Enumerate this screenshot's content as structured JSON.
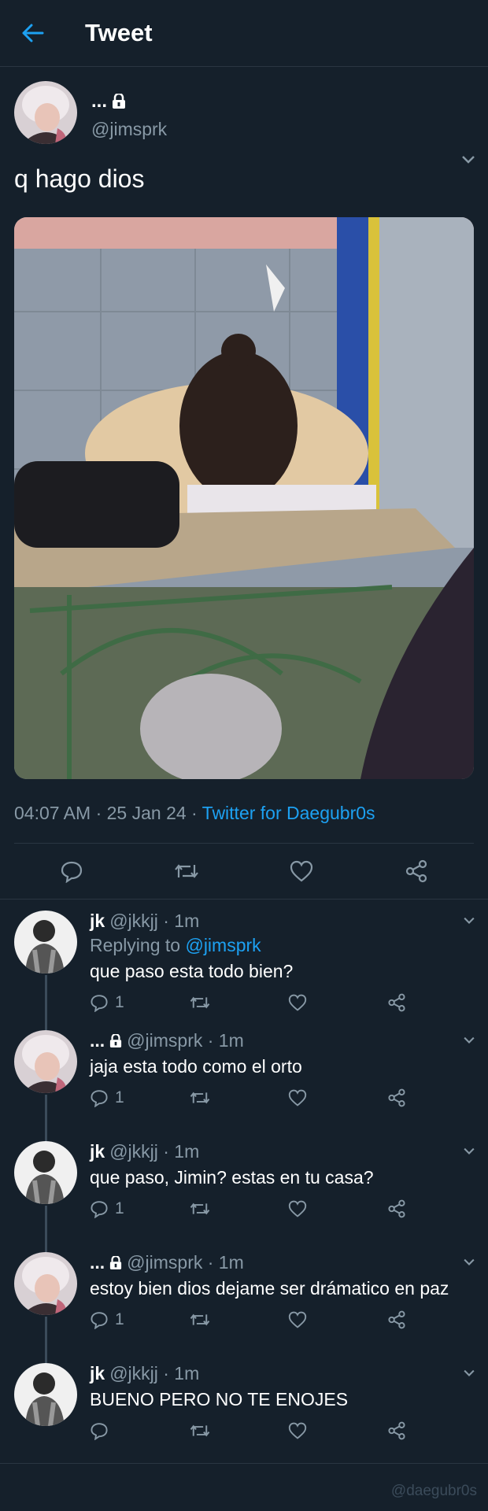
{
  "header": {
    "title": "Tweet",
    "back_icon": "arrow-left-icon"
  },
  "tweet": {
    "display_name": "...",
    "username": "@jimsprk",
    "text": "q hago dios",
    "timestamp": "04:07 AM · 25 Jan 24 · ",
    "source": "Twitter for Daegubr0s"
  },
  "replies": [
    {
      "name": "jk",
      "handle": "@jkkjj · 1m",
      "replying_label": "Replying to ",
      "replying_handle": "@jimsprk",
      "text": "que paso esta todo bien?",
      "reply_count": "1",
      "locked": false
    },
    {
      "name": "...",
      "handle": "@jimsprk · 1m",
      "text": "jaja esta todo como el orto",
      "reply_count": "1",
      "locked": true
    },
    {
      "name": "jk",
      "handle": "@jkkjj · 1m",
      "text": "que paso, Jimin? estas en tu casa?",
      "reply_count": "1",
      "locked": false
    },
    {
      "name": "...",
      "handle": "@jimsprk · 1m",
      "text": "estoy bien dios dejame ser drámatico en paz",
      "reply_count": "1",
      "locked": true
    },
    {
      "name": "jk",
      "handle": "@jkkjj · 1m",
      "text": "BUENO PERO NO TE ENOJES",
      "reply_count": "",
      "locked": false
    }
  ],
  "footer": {
    "watermark": "@daegubr0s"
  },
  "colors": {
    "background": "#15202b",
    "accent": "#1da1f2",
    "muted": "#8899a6",
    "divider": "#2a3642"
  }
}
